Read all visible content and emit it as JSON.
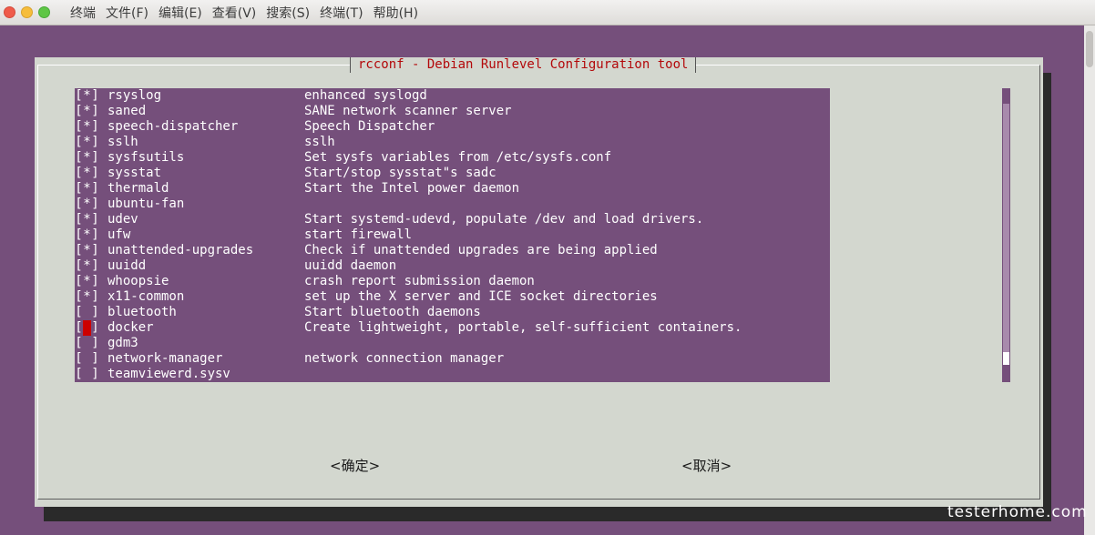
{
  "window": {
    "menu": [
      "终端",
      "文件(F)",
      "编辑(E)",
      "查看(V)",
      "搜索(S)",
      "终端(T)",
      "帮助(H)"
    ]
  },
  "dialog": {
    "title": "rcconf - Debian Runlevel Configuration tool",
    "services": [
      {
        "checked": true,
        "name": "rsyslog",
        "description": "enhanced syslogd"
      },
      {
        "checked": true,
        "name": "saned",
        "description": "SANE network scanner server"
      },
      {
        "checked": true,
        "name": "speech-dispatcher",
        "description": "Speech Dispatcher"
      },
      {
        "checked": true,
        "name": "sslh",
        "description": "sslh"
      },
      {
        "checked": true,
        "name": "sysfsutils",
        "description": "Set sysfs variables from /etc/sysfs.conf"
      },
      {
        "checked": true,
        "name": "sysstat",
        "description": "Start/stop sysstat\"s sadc"
      },
      {
        "checked": true,
        "name": "thermald",
        "description": "Start the Intel power daemon"
      },
      {
        "checked": true,
        "name": "ubuntu-fan",
        "description": ""
      },
      {
        "checked": true,
        "name": "udev",
        "description": "Start systemd-udevd, populate /dev and load drivers."
      },
      {
        "checked": true,
        "name": "ufw",
        "description": "start firewall"
      },
      {
        "checked": true,
        "name": "unattended-upgrades",
        "description": "Check if unattended upgrades are being applied"
      },
      {
        "checked": true,
        "name": "uuidd",
        "description": "uuidd daemon"
      },
      {
        "checked": true,
        "name": "whoopsie",
        "description": "crash report submission daemon"
      },
      {
        "checked": true,
        "name": "x11-common",
        "description": "set up the X server and ICE socket directories"
      },
      {
        "checked": false,
        "name": "bluetooth",
        "description": "Start bluetooth daemons"
      },
      {
        "checked": false,
        "name": "docker",
        "description": "Create lightweight, portable, self-sufficient containers.",
        "cursor": true
      },
      {
        "checked": false,
        "name": "gdm3",
        "description": ""
      },
      {
        "checked": false,
        "name": "network-manager",
        "description": "network connection manager"
      },
      {
        "checked": false,
        "name": "teamviewerd.sysv",
        "description": ""
      }
    ],
    "ok_label": "<确定>",
    "cancel_label": "<取消>"
  },
  "watermark": "testerhome.com",
  "colors": {
    "background": "#754f7b",
    "dialog": "#d3d7cf",
    "title_text": "#b3080a",
    "cursor": "#cc0000"
  }
}
